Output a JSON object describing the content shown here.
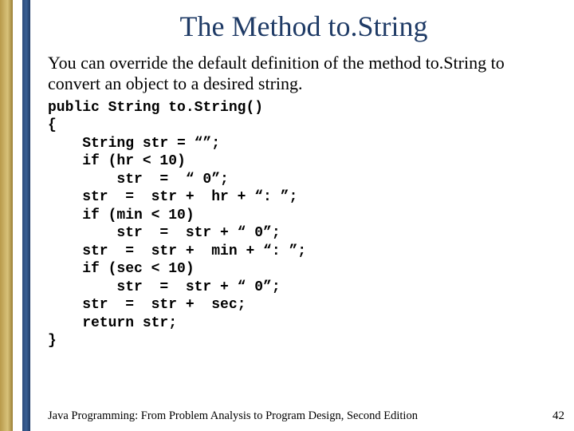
{
  "title": "The Method to.String",
  "description": "You can override the default definition of the method to.String to convert an object to a desired string.",
  "code": "public String to.String()\n{\n    String str = “”;\n    if (hr < 10)\n        str  =  “ 0”;\n    str  =  str +  hr + “: ”;\n    if (min < 10)\n        str  =  str + “ 0”;\n    str  =  str +  min + “: ”;\n    if (sec < 10)\n        str  =  str + “ 0”;\n    str  =  str +  sec;\n    return str;\n}",
  "footer": {
    "left": "Java Programming: From Problem Analysis to Program Design, Second Edition",
    "page": "42"
  }
}
